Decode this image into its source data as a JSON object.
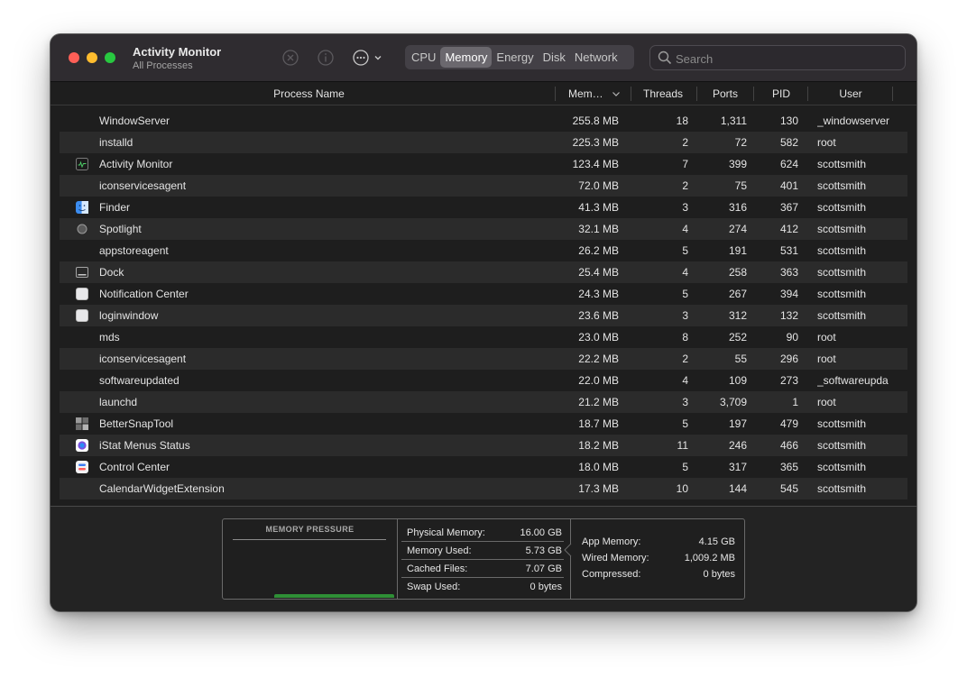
{
  "app": {
    "title": "Activity Monitor",
    "subtitle": "All Processes"
  },
  "toolbar": {
    "stop_icon": "stop-process-icon",
    "info_icon": "info-icon",
    "more_icon": "ellipsis-circle-icon"
  },
  "tabs": [
    {
      "label": "CPU",
      "active": false
    },
    {
      "label": "Memory",
      "active": true
    },
    {
      "label": "Energy",
      "active": false
    },
    {
      "label": "Disk",
      "active": false
    },
    {
      "label": "Network",
      "active": false
    }
  ],
  "search": {
    "placeholder": "Search",
    "value": ""
  },
  "columns": {
    "name": "Process Name",
    "memory": "Mem…",
    "threads": "Threads",
    "ports": "Ports",
    "pid": "PID",
    "user": "User"
  },
  "processes": [
    {
      "name": "WindowServer",
      "memory": "255.8 MB",
      "threads": "18",
      "ports": "1,311",
      "pid": "130",
      "user": "_windowserver",
      "icon": "none"
    },
    {
      "name": "installd",
      "memory": "225.3 MB",
      "threads": "2",
      "ports": "72",
      "pid": "582",
      "user": "root",
      "icon": "none"
    },
    {
      "name": "Activity Monitor",
      "memory": "123.4 MB",
      "threads": "7",
      "ports": "399",
      "pid": "624",
      "user": "scottsmith",
      "icon": "activity-monitor-icon"
    },
    {
      "name": "iconservicesagent",
      "memory": "72.0 MB",
      "threads": "2",
      "ports": "75",
      "pid": "401",
      "user": "scottsmith",
      "icon": "none"
    },
    {
      "name": "Finder",
      "memory": "41.3 MB",
      "threads": "3",
      "ports": "316",
      "pid": "367",
      "user": "scottsmith",
      "icon": "finder-icon"
    },
    {
      "name": "Spotlight",
      "memory": "32.1 MB",
      "threads": "4",
      "ports": "274",
      "pid": "412",
      "user": "scottsmith",
      "icon": "spotlight-icon"
    },
    {
      "name": "appstoreagent",
      "memory": "26.2 MB",
      "threads": "5",
      "ports": "191",
      "pid": "531",
      "user": "scottsmith",
      "icon": "none"
    },
    {
      "name": "Dock",
      "memory": "25.4 MB",
      "threads": "4",
      "ports": "258",
      "pid": "363",
      "user": "scottsmith",
      "icon": "dock-icon"
    },
    {
      "name": "Notification Center",
      "memory": "24.3 MB",
      "threads": "5",
      "ports": "267",
      "pid": "394",
      "user": "scottsmith",
      "icon": "generic-app-icon"
    },
    {
      "name": "loginwindow",
      "memory": "23.6 MB",
      "threads": "3",
      "ports": "312",
      "pid": "132",
      "user": "scottsmith",
      "icon": "generic-app-icon"
    },
    {
      "name": "mds",
      "memory": "23.0 MB",
      "threads": "8",
      "ports": "252",
      "pid": "90",
      "user": "root",
      "icon": "none"
    },
    {
      "name": "iconservicesagent",
      "memory": "22.2 MB",
      "threads": "2",
      "ports": "55",
      "pid": "296",
      "user": "root",
      "icon": "none"
    },
    {
      "name": "softwareupdated",
      "memory": "22.0 MB",
      "threads": "4",
      "ports": "109",
      "pid": "273",
      "user": "_softwareupda",
      "icon": "none"
    },
    {
      "name": "launchd",
      "memory": "21.2 MB",
      "threads": "3",
      "ports": "3,709",
      "pid": "1",
      "user": "root",
      "icon": "none"
    },
    {
      "name": "BetterSnapTool",
      "memory": "18.7 MB",
      "threads": "5",
      "ports": "197",
      "pid": "479",
      "user": "scottsmith",
      "icon": "bettersnaptool-icon"
    },
    {
      "name": "iStat Menus Status",
      "memory": "18.2 MB",
      "threads": "11",
      "ports": "246",
      "pid": "466",
      "user": "scottsmith",
      "icon": "istat-menus-icon"
    },
    {
      "name": "Control Center",
      "memory": "18.0 MB",
      "threads": "5",
      "ports": "317",
      "pid": "365",
      "user": "scottsmith",
      "icon": "control-center-icon"
    },
    {
      "name": "CalendarWidgetExtension",
      "memory": "17.3 MB",
      "threads": "10",
      "ports": "144",
      "pid": "545",
      "user": "scottsmith",
      "icon": "none"
    }
  ],
  "memory_summary": {
    "pressure_title": "MEMORY PRESSURE",
    "pressure_color": "#2f8f36",
    "physical_label": "Physical Memory:",
    "physical_value": "16.00 GB",
    "used_label": "Memory Used:",
    "used_value": "5.73 GB",
    "cached_label": "Cached Files:",
    "cached_value": "7.07 GB",
    "swap_label": "Swap Used:",
    "swap_value": "0 bytes",
    "app_label": "App Memory:",
    "app_value": "4.15 GB",
    "wired_label": "Wired Memory:",
    "wired_value": "1,009.2 MB",
    "compressed_label": "Compressed:",
    "compressed_value": "0 bytes"
  }
}
